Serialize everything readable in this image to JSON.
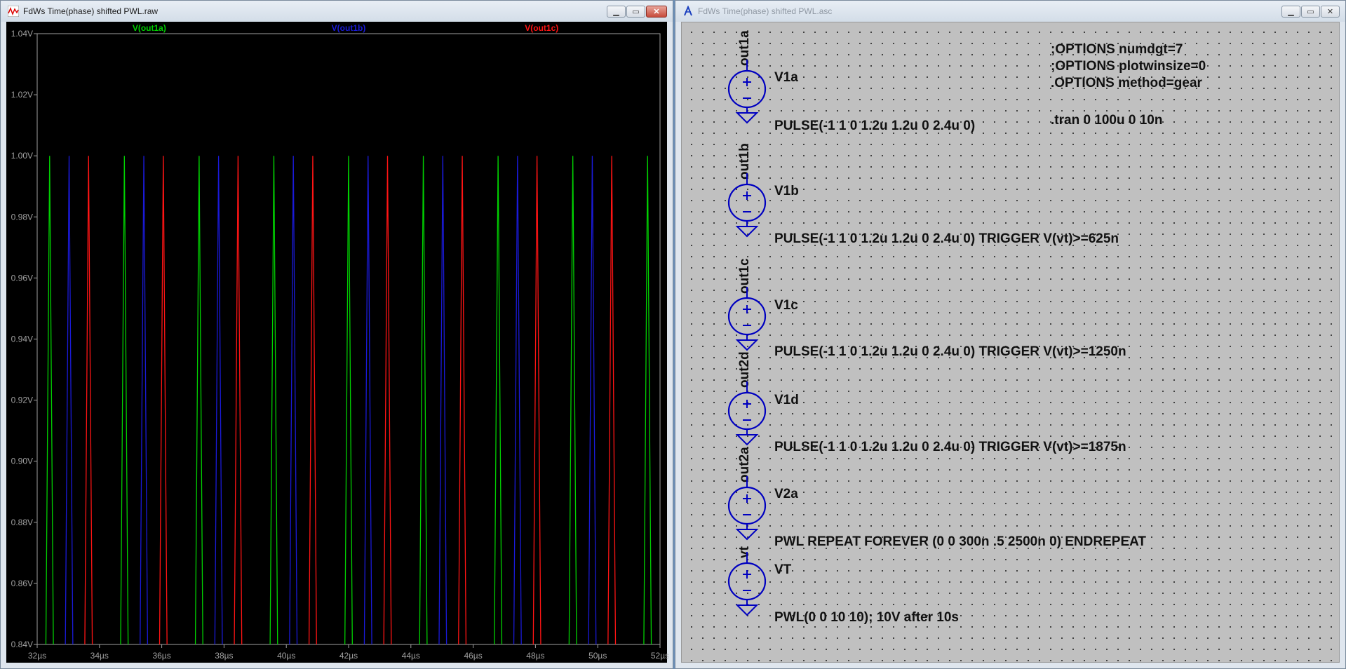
{
  "waveform_window": {
    "title": "FdWs Time(phase) shifted PWL.raw",
    "icon": "waveform-icon",
    "buttons": {
      "minimize": "minimize-icon",
      "maximize": "maximize-icon",
      "close": "close-icon"
    }
  },
  "schematic_window": {
    "title": "FdWs Time(phase) shifted PWL.asc",
    "icon": "schematic-icon",
    "buttons": {
      "minimize": "minimize-icon",
      "maximize": "maximize-icon",
      "close": "close-icon"
    }
  },
  "chart_data": {
    "type": "line",
    "background": "#000000",
    "xlim": [
      32,
      52
    ],
    "ylim": [
      0.84,
      1.04
    ],
    "x_unit": "µs",
    "x_ticks": [
      "32µs",
      "34µs",
      "36µs",
      "38µs",
      "40µs",
      "42µs",
      "44µs",
      "46µs",
      "48µs",
      "50µs",
      "52µs"
    ],
    "y_ticks": [
      "0.84V",
      "0.86V",
      "0.88V",
      "0.90V",
      "0.92V",
      "0.94V",
      "0.96V",
      "0.98V",
      "1.00V",
      "1.02V",
      "1.04V"
    ],
    "legend_placement": "top",
    "series": [
      {
        "name": "V(out1a)",
        "color": "#00d000",
        "peaks_us": [
          32.4,
          34.8,
          37.2,
          39.6,
          42.0,
          44.4,
          46.8,
          49.2,
          51.6
        ],
        "peak_v": 1.0,
        "half_width_us": 0.12
      },
      {
        "name": "V(out1b)",
        "color": "#1a1ad8",
        "peaks_us": [
          33.025,
          35.425,
          37.825,
          40.225,
          42.625,
          45.025,
          47.425,
          49.825
        ],
        "peak_v": 1.0,
        "half_width_us": 0.12
      },
      {
        "name": "V(out1c)",
        "color": "#ff1414",
        "peaks_us": [
          33.65,
          36.05,
          38.45,
          40.85,
          43.25,
          45.65,
          48.05,
          50.45
        ],
        "peak_v": 1.0,
        "half_width_us": 0.12
      }
    ]
  },
  "schematic": {
    "colors": {
      "symbol": "#0000c0",
      "text": "#111111"
    },
    "directives": [
      ";OPTIONS numdgt=7",
      ";OPTIONS plotwinsize=0",
      ".OPTIONS method=gear",
      ".tran 0 100u 0 10n"
    ],
    "sources": [
      {
        "net": "out1a",
        "name": "V1a",
        "value": "PULSE(-1 1 0 1.2u 1.2u 0 2.4u 0)"
      },
      {
        "net": "out1b",
        "name": "V1b",
        "value": "PULSE(-1 1 0 1.2u 1.2u 0 2.4u 0) TRIGGER V(vt)>=625n"
      },
      {
        "net": "out1c",
        "name": "V1c",
        "value": "PULSE(-1 1 0 1.2u 1.2u 0 2.4u 0) TRIGGER V(vt)>=1250n"
      },
      {
        "net": "out2d",
        "name": "V1d",
        "value": "PULSE(-1 1 0 1.2u 1.2u 0 2.4u 0) TRIGGER V(vt)>=1875n"
      },
      {
        "net": "out2a",
        "name": "V2a",
        "value": "PWL REPEAT FOREVER (0 0 300n .5 2500n 0) ENDREPEAT"
      },
      {
        "net": "vt",
        "name": "VT",
        "value": "PWL(0 0 10 10); 10V after 10s"
      }
    ]
  }
}
